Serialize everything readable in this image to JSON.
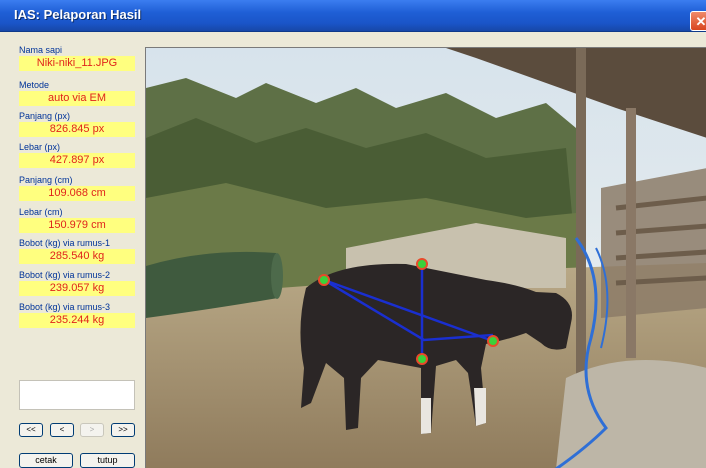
{
  "window": {
    "title": "IAS: Pelaporan Hasil",
    "close_glyph": "✕"
  },
  "fields": [
    {
      "label": "Nama sapi",
      "value": "Niki-niki_11.JPG"
    },
    {
      "label": "Metode",
      "value": "auto via EM"
    },
    {
      "label": "Panjang (px)",
      "value": "826.845 px"
    },
    {
      "label": "Lebar (px)",
      "value": "427.897 px"
    },
    {
      "label": "Panjang (cm)",
      "value": "109.068 cm"
    },
    {
      "label": "Lebar (cm)",
      "value": "150.979 cm"
    },
    {
      "label": "Bobot (kg) via rumus-1",
      "value": "285.540 kg"
    },
    {
      "label": "Bobot (kg) via rumus-2",
      "value": "239.057 kg"
    },
    {
      "label": "Bobot (kg) via rumus-3",
      "value": "235.244 kg"
    }
  ],
  "note_box": "",
  "nav": {
    "first": "<<",
    "prev": "<",
    "next": ">",
    "last": ">>"
  },
  "actions": {
    "print": "cetak",
    "close": "tutup"
  },
  "colors": {
    "label_blue": "#003399",
    "value_yellow": "#ffff7f",
    "value_red": "#e0241b",
    "measure_line": "#1a2fd0",
    "marker_green": "#3ad13a",
    "marker_ring": "#e84a2a"
  },
  "photo": {
    "subject": "cow with measurement overlay",
    "markers": 4
  }
}
